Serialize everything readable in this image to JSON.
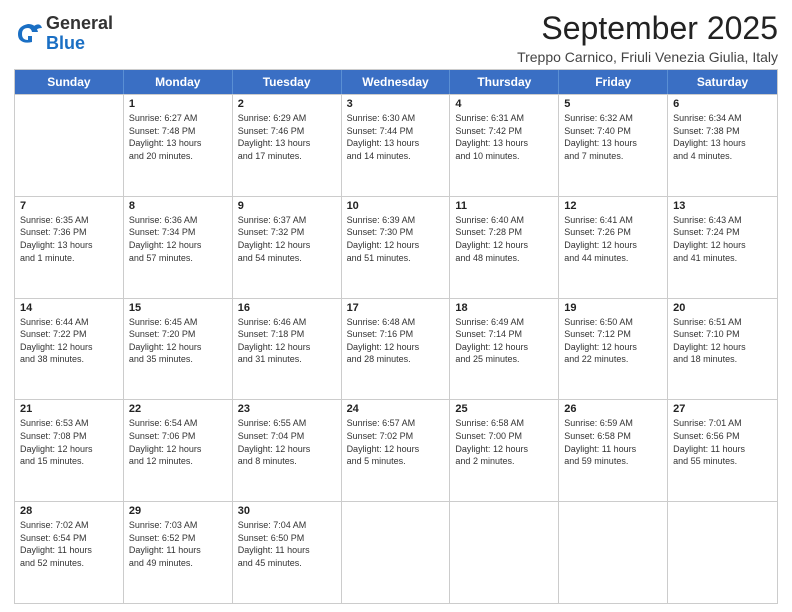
{
  "header": {
    "logo": {
      "general": "General",
      "blue": "Blue"
    },
    "title": "September 2025",
    "subtitle": "Treppo Carnico, Friuli Venezia Giulia, Italy"
  },
  "days_of_week": [
    "Sunday",
    "Monday",
    "Tuesday",
    "Wednesday",
    "Thursday",
    "Friday",
    "Saturday"
  ],
  "weeks": [
    [
      {
        "day": "",
        "info": ""
      },
      {
        "day": "1",
        "info": "Sunrise: 6:27 AM\nSunset: 7:48 PM\nDaylight: 13 hours\nand 20 minutes."
      },
      {
        "day": "2",
        "info": "Sunrise: 6:29 AM\nSunset: 7:46 PM\nDaylight: 13 hours\nand 17 minutes."
      },
      {
        "day": "3",
        "info": "Sunrise: 6:30 AM\nSunset: 7:44 PM\nDaylight: 13 hours\nand 14 minutes."
      },
      {
        "day": "4",
        "info": "Sunrise: 6:31 AM\nSunset: 7:42 PM\nDaylight: 13 hours\nand 10 minutes."
      },
      {
        "day": "5",
        "info": "Sunrise: 6:32 AM\nSunset: 7:40 PM\nDaylight: 13 hours\nand 7 minutes."
      },
      {
        "day": "6",
        "info": "Sunrise: 6:34 AM\nSunset: 7:38 PM\nDaylight: 13 hours\nand 4 minutes."
      }
    ],
    [
      {
        "day": "7",
        "info": "Sunrise: 6:35 AM\nSunset: 7:36 PM\nDaylight: 13 hours\nand 1 minute."
      },
      {
        "day": "8",
        "info": "Sunrise: 6:36 AM\nSunset: 7:34 PM\nDaylight: 12 hours\nand 57 minutes."
      },
      {
        "day": "9",
        "info": "Sunrise: 6:37 AM\nSunset: 7:32 PM\nDaylight: 12 hours\nand 54 minutes."
      },
      {
        "day": "10",
        "info": "Sunrise: 6:39 AM\nSunset: 7:30 PM\nDaylight: 12 hours\nand 51 minutes."
      },
      {
        "day": "11",
        "info": "Sunrise: 6:40 AM\nSunset: 7:28 PM\nDaylight: 12 hours\nand 48 minutes."
      },
      {
        "day": "12",
        "info": "Sunrise: 6:41 AM\nSunset: 7:26 PM\nDaylight: 12 hours\nand 44 minutes."
      },
      {
        "day": "13",
        "info": "Sunrise: 6:43 AM\nSunset: 7:24 PM\nDaylight: 12 hours\nand 41 minutes."
      }
    ],
    [
      {
        "day": "14",
        "info": "Sunrise: 6:44 AM\nSunset: 7:22 PM\nDaylight: 12 hours\nand 38 minutes."
      },
      {
        "day": "15",
        "info": "Sunrise: 6:45 AM\nSunset: 7:20 PM\nDaylight: 12 hours\nand 35 minutes."
      },
      {
        "day": "16",
        "info": "Sunrise: 6:46 AM\nSunset: 7:18 PM\nDaylight: 12 hours\nand 31 minutes."
      },
      {
        "day": "17",
        "info": "Sunrise: 6:48 AM\nSunset: 7:16 PM\nDaylight: 12 hours\nand 28 minutes."
      },
      {
        "day": "18",
        "info": "Sunrise: 6:49 AM\nSunset: 7:14 PM\nDaylight: 12 hours\nand 25 minutes."
      },
      {
        "day": "19",
        "info": "Sunrise: 6:50 AM\nSunset: 7:12 PM\nDaylight: 12 hours\nand 22 minutes."
      },
      {
        "day": "20",
        "info": "Sunrise: 6:51 AM\nSunset: 7:10 PM\nDaylight: 12 hours\nand 18 minutes."
      }
    ],
    [
      {
        "day": "21",
        "info": "Sunrise: 6:53 AM\nSunset: 7:08 PM\nDaylight: 12 hours\nand 15 minutes."
      },
      {
        "day": "22",
        "info": "Sunrise: 6:54 AM\nSunset: 7:06 PM\nDaylight: 12 hours\nand 12 minutes."
      },
      {
        "day": "23",
        "info": "Sunrise: 6:55 AM\nSunset: 7:04 PM\nDaylight: 12 hours\nand 8 minutes."
      },
      {
        "day": "24",
        "info": "Sunrise: 6:57 AM\nSunset: 7:02 PM\nDaylight: 12 hours\nand 5 minutes."
      },
      {
        "day": "25",
        "info": "Sunrise: 6:58 AM\nSunset: 7:00 PM\nDaylight: 12 hours\nand 2 minutes."
      },
      {
        "day": "26",
        "info": "Sunrise: 6:59 AM\nSunset: 6:58 PM\nDaylight: 11 hours\nand 59 minutes."
      },
      {
        "day": "27",
        "info": "Sunrise: 7:01 AM\nSunset: 6:56 PM\nDaylight: 11 hours\nand 55 minutes."
      }
    ],
    [
      {
        "day": "28",
        "info": "Sunrise: 7:02 AM\nSunset: 6:54 PM\nDaylight: 11 hours\nand 52 minutes."
      },
      {
        "day": "29",
        "info": "Sunrise: 7:03 AM\nSunset: 6:52 PM\nDaylight: 11 hours\nand 49 minutes."
      },
      {
        "day": "30",
        "info": "Sunrise: 7:04 AM\nSunset: 6:50 PM\nDaylight: 11 hours\nand 45 minutes."
      },
      {
        "day": "",
        "info": ""
      },
      {
        "day": "",
        "info": ""
      },
      {
        "day": "",
        "info": ""
      },
      {
        "day": "",
        "info": ""
      }
    ]
  ]
}
